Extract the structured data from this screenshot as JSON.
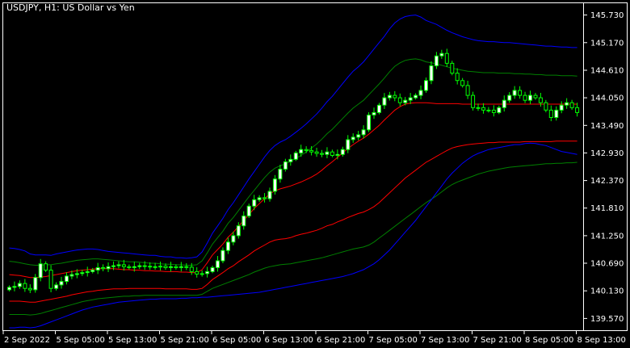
{
  "window": {
    "title": "USDJPY, H1:  US Dollar vs Yen",
    "symbol": "USDJPY",
    "timeframe": "H1",
    "description": "US Dollar vs Yen"
  },
  "colors": {
    "background": "#000000",
    "border": "#ffffff",
    "candle_bull_body": "#ffffff",
    "candle_bear_body": "#000000",
    "candle_wick": "#00ff00",
    "band_outer": "#0000ff",
    "band_middle": "#008000",
    "band_inner": "#ff0000"
  },
  "chart_data": {
    "type": "candlestick",
    "title": "USDJPY, H1:  US Dollar vs Yen",
    "xlabel": "",
    "ylabel": "",
    "ylim": [
      139.33,
      145.97
    ],
    "grid": false,
    "price_axis_labels": [
      "145.730",
      "145.170",
      "144.610",
      "144.050",
      "143.490",
      "142.930",
      "142.370",
      "141.810",
      "141.250",
      "140.690",
      "140.130",
      "139.570"
    ],
    "time_axis_labels": [
      "2 Sep 2022",
      "5 Sep 05:00",
      "5 Sep 13:00",
      "5 Sep 21:00",
      "6 Sep 05:00",
      "6 Sep 13:00",
      "6 Sep 21:00",
      "7 Sep 05:00",
      "7 Sep 13:00",
      "7 Sep 21:00",
      "8 Sep 05:00",
      "8 Sep 13:00"
    ],
    "close": [
      140.2,
      140.22,
      140.28,
      140.18,
      140.15,
      140.4,
      140.68,
      140.55,
      140.18,
      140.25,
      140.32,
      140.43,
      140.46,
      140.48,
      140.5,
      140.52,
      140.55,
      140.6,
      140.58,
      140.62,
      140.64,
      140.66,
      140.62,
      140.6,
      140.62,
      140.64,
      140.63,
      140.62,
      140.62,
      140.63,
      140.6,
      140.62,
      140.6,
      140.62,
      140.61,
      140.52,
      140.47,
      140.48,
      140.52,
      140.6,
      140.74,
      140.95,
      141.12,
      141.25,
      141.45,
      141.65,
      141.85,
      141.98,
      142.02,
      142.0,
      142.15,
      142.4,
      142.6,
      142.75,
      142.8,
      142.93,
      143.0,
      142.98,
      142.95,
      142.92,
      142.9,
      142.95,
      142.88,
      142.9,
      143.0,
      143.2,
      143.25,
      143.3,
      143.4,
      143.7,
      143.75,
      143.9,
      144.05,
      144.1,
      144.05,
      143.95,
      144.0,
      144.05,
      144.1,
      144.2,
      144.4,
      144.7,
      144.9,
      144.95,
      144.75,
      144.55,
      144.4,
      144.3,
      144.1,
      143.85,
      143.85,
      143.8,
      143.8,
      143.75,
      143.85,
      144.0,
      144.1,
      144.2,
      144.1,
      144.0,
      144.1,
      144.05,
      143.95,
      143.8,
      143.65,
      143.8,
      143.9,
      143.95,
      143.85,
      143.75
    ],
    "bands": [
      {
        "name": "",
        "color": "#0000ff",
        "values": [
          141.0,
          140.99,
          140.97,
          140.94,
          140.88,
          140.86,
          140.86,
          140.86,
          140.85,
          140.88,
          140.9,
          140.92,
          140.94,
          140.96,
          140.97,
          140.98,
          140.98,
          140.97,
          140.95,
          140.93,
          140.92,
          140.91,
          140.9,
          140.89,
          140.88,
          140.87,
          140.86,
          140.85,
          140.85,
          140.83,
          140.82,
          140.82,
          140.8,
          140.8,
          140.79,
          140.8,
          140.82,
          140.92,
          141.1,
          141.3,
          141.45,
          141.6,
          141.78,
          141.92,
          142.08,
          142.24,
          142.4,
          142.55,
          142.7,
          142.85,
          142.98,
          143.08,
          143.15,
          143.2,
          143.27,
          143.35,
          143.43,
          143.52,
          143.62,
          143.72,
          143.84,
          143.97,
          144.08,
          144.21,
          144.34,
          144.47,
          144.59,
          144.68,
          144.78,
          144.91,
          145.04,
          145.17,
          145.3,
          145.45,
          145.57,
          145.65,
          145.7,
          145.72,
          145.73,
          145.69,
          145.62,
          145.58,
          145.54,
          145.48,
          145.42,
          145.37,
          145.33,
          145.29,
          145.26,
          145.23,
          145.21,
          145.2,
          145.19,
          145.19,
          145.18,
          145.17,
          145.17,
          145.16,
          145.15,
          145.14,
          145.13,
          145.12,
          145.11,
          145.1,
          145.1,
          145.09,
          145.08,
          145.08,
          145.07,
          145.07
        ]
      },
      {
        "name": "",
        "color": "#008000",
        "values": [
          140.73,
          140.72,
          140.7,
          140.68,
          140.66,
          140.65,
          140.65,
          140.66,
          140.66,
          140.68,
          140.69,
          140.71,
          140.73,
          140.75,
          140.76,
          140.77,
          140.78,
          140.78,
          140.77,
          140.76,
          140.75,
          140.74,
          140.73,
          140.72,
          140.72,
          140.71,
          140.7,
          140.69,
          140.69,
          140.68,
          140.67,
          140.67,
          140.66,
          140.66,
          140.65,
          140.65,
          140.66,
          140.74,
          140.9,
          141.08,
          141.21,
          141.34,
          141.5,
          141.62,
          141.76,
          141.9,
          142.04,
          142.17,
          142.3,
          142.43,
          142.54,
          142.62,
          142.67,
          142.71,
          142.76,
          142.82,
          142.88,
          142.95,
          143.03,
          143.11,
          143.21,
          143.32,
          143.41,
          143.52,
          143.63,
          143.74,
          143.84,
          143.92,
          144.0,
          144.11,
          144.22,
          144.33,
          144.45,
          144.58,
          144.69,
          144.76,
          144.81,
          144.83,
          144.84,
          144.82,
          144.78,
          144.76,
          144.74,
          144.71,
          144.68,
          144.65,
          144.63,
          144.61,
          144.59,
          144.58,
          144.57,
          144.56,
          144.56,
          144.56,
          144.55,
          144.55,
          144.55,
          144.54,
          144.54,
          144.53,
          144.53,
          144.52,
          144.52,
          144.51,
          144.51,
          144.51,
          144.5,
          144.5,
          144.5,
          144.49
        ]
      },
      {
        "name": "",
        "color": "#ff0000",
        "values": [
          140.46,
          140.45,
          140.44,
          140.42,
          140.4,
          140.4,
          140.41,
          140.42,
          140.44,
          140.46,
          140.48,
          140.5,
          140.52,
          140.54,
          140.55,
          140.56,
          140.57,
          140.58,
          140.58,
          140.58,
          140.58,
          140.57,
          140.56,
          140.56,
          140.55,
          140.55,
          140.54,
          140.54,
          140.53,
          140.53,
          140.52,
          140.52,
          140.52,
          140.51,
          140.51,
          140.5,
          140.5,
          140.56,
          140.7,
          140.86,
          140.97,
          141.08,
          141.22,
          141.32,
          141.44,
          141.56,
          141.68,
          141.8,
          141.9,
          142.0,
          142.1,
          142.16,
          142.2,
          142.23,
          142.26,
          142.3,
          142.34,
          142.39,
          142.44,
          142.5,
          142.58,
          142.67,
          142.75,
          142.84,
          142.93,
          143.02,
          143.1,
          143.17,
          143.23,
          143.31,
          143.4,
          143.49,
          143.6,
          143.7,
          143.8,
          143.87,
          143.92,
          143.94,
          143.95,
          143.95,
          143.95,
          143.94,
          143.93,
          143.93,
          143.93,
          143.93,
          143.93,
          143.92,
          143.92,
          143.92,
          143.92,
          143.92,
          143.92,
          143.92,
          143.92,
          143.92,
          143.92,
          143.92,
          143.92,
          143.92,
          143.92,
          143.92,
          143.92,
          143.92,
          143.92,
          143.92,
          143.92,
          143.92,
          143.92,
          143.92
        ]
      },
      {
        "name": "",
        "color": "#ff0000",
        "values": [
          139.92,
          139.92,
          139.92,
          139.91,
          139.9,
          139.9,
          139.92,
          139.94,
          139.96,
          139.98,
          140.0,
          140.02,
          140.05,
          140.07,
          140.09,
          140.11,
          140.12,
          140.14,
          140.15,
          140.16,
          140.17,
          140.17,
          140.17,
          140.18,
          140.18,
          140.18,
          140.18,
          140.18,
          140.18,
          140.18,
          140.17,
          140.17,
          140.17,
          140.17,
          140.17,
          140.16,
          140.16,
          140.18,
          140.26,
          140.36,
          140.43,
          140.5,
          140.58,
          140.64,
          140.72,
          140.79,
          140.86,
          140.94,
          141.0,
          141.06,
          141.12,
          141.16,
          141.18,
          141.19,
          141.21,
          141.25,
          141.28,
          141.3,
          141.33,
          141.36,
          141.4,
          141.45,
          141.48,
          141.53,
          141.57,
          141.62,
          141.66,
          141.7,
          141.73,
          141.78,
          141.84,
          141.92,
          142.02,
          142.12,
          142.22,
          142.32,
          142.42,
          142.5,
          142.58,
          142.66,
          142.74,
          142.8,
          142.86,
          142.92,
          142.98,
          143.03,
          143.06,
          143.08,
          143.1,
          143.11,
          143.12,
          143.13,
          143.14,
          143.14,
          143.15,
          143.15,
          143.15,
          143.15,
          143.15,
          143.16,
          143.16,
          143.16,
          143.16,
          143.16,
          143.16,
          143.17,
          143.17,
          143.17,
          143.17,
          143.17
        ]
      },
      {
        "name": "",
        "color": "#008000",
        "values": [
          139.65,
          139.65,
          139.65,
          139.65,
          139.64,
          139.65,
          139.67,
          139.7,
          139.73,
          139.76,
          139.79,
          139.82,
          139.85,
          139.88,
          139.91,
          139.93,
          139.95,
          139.97,
          139.98,
          139.99,
          140.0,
          140.01,
          140.02,
          140.02,
          140.03,
          140.03,
          140.04,
          140.04,
          140.04,
          140.04,
          140.04,
          140.04,
          140.04,
          140.04,
          140.04,
          140.04,
          140.04,
          140.06,
          140.12,
          140.18,
          140.22,
          140.26,
          140.3,
          140.34,
          140.38,
          140.42,
          140.46,
          140.51,
          140.55,
          140.59,
          140.62,
          140.64,
          140.66,
          140.67,
          140.68,
          140.7,
          140.72,
          140.74,
          140.76,
          140.78,
          140.8,
          140.83,
          140.86,
          140.89,
          140.92,
          140.95,
          140.98,
          141.0,
          141.02,
          141.06,
          141.12,
          141.2,
          141.28,
          141.36,
          141.44,
          141.52,
          141.6,
          141.68,
          141.76,
          141.84,
          141.92,
          141.99,
          142.06,
          142.14,
          142.22,
          142.29,
          142.34,
          142.38,
          142.42,
          142.46,
          142.5,
          142.53,
          142.56,
          142.58,
          142.6,
          142.62,
          142.64,
          142.65,
          142.66,
          142.67,
          142.68,
          142.69,
          142.7,
          142.71,
          142.71,
          142.72,
          142.72,
          142.73,
          142.73,
          142.74
        ]
      },
      {
        "name": "",
        "color": "#0000ff",
        "values": [
          139.38,
          139.38,
          139.39,
          139.39,
          139.38,
          139.39,
          139.42,
          139.46,
          139.5,
          139.54,
          139.58,
          139.62,
          139.66,
          139.7,
          139.74,
          139.77,
          139.8,
          139.82,
          139.84,
          139.86,
          139.88,
          139.9,
          139.91,
          139.92,
          139.93,
          139.94,
          139.95,
          139.96,
          139.96,
          139.97,
          139.97,
          139.97,
          139.97,
          139.98,
          139.98,
          139.99,
          139.99,
          140.0,
          140.0,
          140.01,
          140.02,
          140.03,
          140.04,
          140.05,
          140.06,
          140.07,
          140.08,
          140.09,
          140.1,
          140.12,
          140.14,
          140.16,
          140.18,
          140.2,
          140.22,
          140.24,
          140.26,
          140.28,
          140.3,
          140.32,
          140.34,
          140.36,
          140.38,
          140.4,
          140.42,
          140.45,
          140.48,
          140.52,
          140.56,
          140.62,
          140.68,
          140.76,
          140.86,
          140.96,
          141.08,
          141.2,
          141.32,
          141.44,
          141.56,
          141.7,
          141.84,
          141.98,
          142.12,
          142.26,
          142.4,
          142.52,
          142.62,
          142.72,
          142.8,
          142.87,
          142.92,
          142.96,
          143.0,
          143.02,
          143.04,
          143.06,
          143.08,
          143.1,
          143.1,
          143.12,
          143.13,
          143.12,
          143.1,
          143.08,
          143.04,
          143.0,
          142.96,
          142.94,
          142.92,
          142.9
        ]
      }
    ]
  }
}
